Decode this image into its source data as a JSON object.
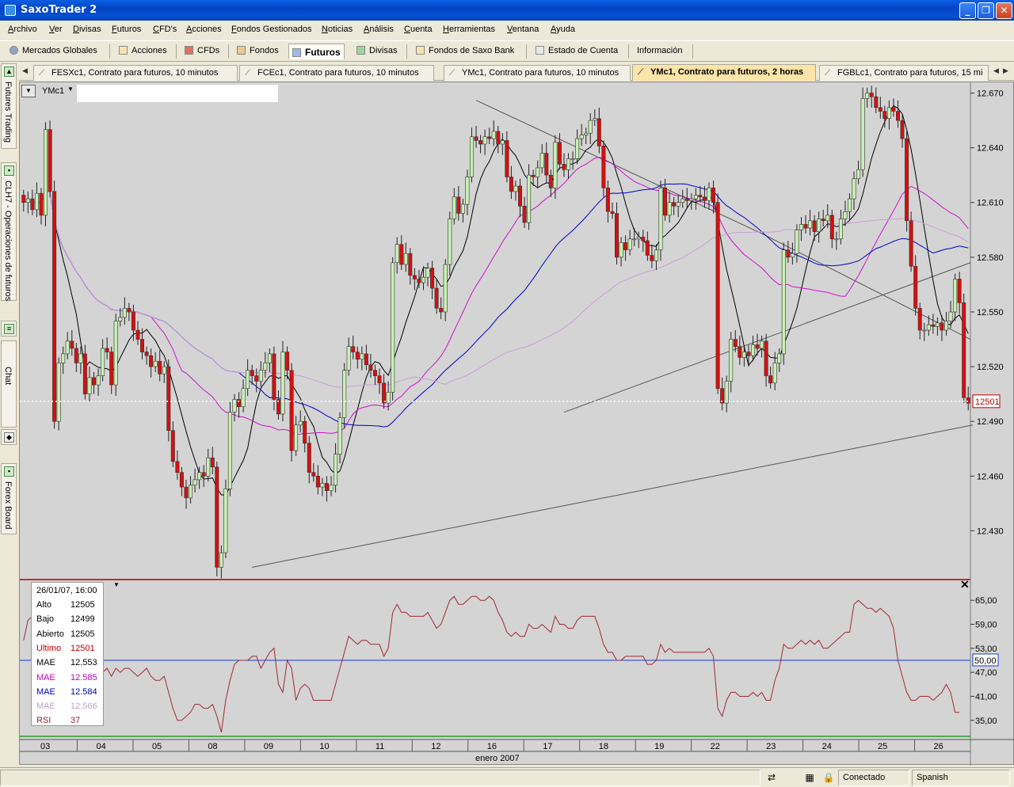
{
  "window": {
    "title": "SaxoTrader 2",
    "min": "_",
    "max": "❐",
    "close": "✕"
  },
  "menu": [
    "Archivo",
    "Ver",
    "Divisas",
    "Futuros",
    "CFD's",
    "Acciones",
    "Fondos Gestionados",
    "Noticias",
    "Análisis",
    "Cuenta",
    "Herramientas",
    "Ventana",
    "Ayuda"
  ],
  "toolbar": {
    "items": [
      "Mercados Globales",
      "Acciones",
      "CFDs",
      "Fondos",
      "Futuros",
      "Divisas",
      "Fondos de Saxo Bank",
      "Estado de Cuenta",
      "Información"
    ],
    "active": "Futuros"
  },
  "tabs": [
    "FESXc1, Contrato para futuros, 10 minutos",
    "FCEc1, Contrato para futuros, 10 minutos",
    "YMc1, Contrato para futuros, 10 minutos",
    "YMc1, Contrato para futuros, 2 horas",
    "FGBLc1, Contrato para futuros, 15 mi"
  ],
  "dock": [
    "Futures Trading",
    "CLH7 - Operaciones de futuros",
    "Chat",
    "Forex Board"
  ],
  "chart": {
    "symbol": "YMc1",
    "last_badge": "12501"
  },
  "chart_data": {
    "type": "candlestick",
    "symbol": "YMc1",
    "interval": "2 horas",
    "yticks": [
      12670,
      12640,
      12610,
      12580,
      12550,
      12520,
      12490,
      12460,
      12430
    ],
    "ytick_labels": [
      "12.670",
      "12.640",
      "12.610",
      "12.580",
      "12.550",
      "12.520",
      "12.490",
      "12.460",
      "12.430"
    ],
    "ylim": [
      12405,
      12675
    ],
    "last_price": 12501,
    "last_price_label": "12501",
    "x_day_labels": [
      "03",
      "04",
      "05",
      "08",
      "09",
      "10",
      "11",
      "12",
      "16",
      "17",
      "18",
      "19",
      "22",
      "23",
      "24",
      "25",
      "26"
    ],
    "x_month_label": "enero 2007",
    "close_series": [
      12610,
      12612,
      12606,
      12615,
      12603,
      12650,
      12616,
      12490,
      12522,
      12527,
      12534,
      12530,
      12522,
      12527,
      12505,
      12514,
      12510,
      12515,
      12530,
      12528,
      12510,
      12545,
      12547,
      12552,
      12550,
      12540,
      12535,
      12528,
      12526,
      12520,
      12523,
      12516,
      12520,
      12485,
      12468,
      12462,
      12454,
      12448,
      12455,
      12458,
      12462,
      12460,
      12470,
      12465,
      12410,
      12418,
      12453,
      12495,
      12502,
      12498,
      12508,
      12518,
      12515,
      12512,
      12518,
      12522,
      12527,
      12502,
      12494,
      12528,
      12518,
      12474,
      12488,
      12490,
      12478,
      12462,
      12460,
      12454,
      12456,
      12452,
      12455,
      12472,
      12492,
      12518,
      12531,
      12528,
      12524,
      12527,
      12521,
      12518,
      12515,
      12511,
      12500,
      12506,
      12577,
      12587,
      12576,
      12582,
      12570,
      12568,
      12566,
      12569,
      12574,
      12563,
      12552,
      12550,
      12576,
      12601,
      12613,
      12604,
      12609,
      12624,
      12646,
      12644,
      12642,
      12646,
      12645,
      12649,
      12642,
      12644,
      12624,
      12616,
      12619,
      12608,
      12599,
      12625,
      12624,
      12629,
      12637,
      12625,
      12618,
      12643,
      12631,
      12628,
      12634,
      12634,
      12645,
      12647,
      12648,
      12655,
      12656,
      12641,
      12618,
      12605,
      12604,
      12580,
      12588,
      12584,
      12590,
      12590,
      12591,
      12589,
      12581,
      12578,
      12584,
      12618,
      12603,
      12610,
      12608,
      12610,
      12612,
      12611,
      12612,
      12614,
      12613,
      12611,
      12618,
      12610,
      12508,
      12500,
      12512,
      12535,
      12531,
      12525,
      12528,
      12526,
      12532,
      12530,
      12534,
      12515,
      12511,
      12522,
      12527,
      12584,
      12580,
      12582,
      12595,
      12598,
      12596,
      12600,
      12594,
      12601,
      12600,
      12603,
      12590,
      12590,
      12601,
      12605,
      12612,
      12623,
      12628,
      12667,
      12670,
      12668,
      12662,
      12660,
      12656,
      12662,
      12660,
      12655,
      12645,
      12600,
      12575,
      12552,
      12540,
      12540,
      12543,
      12542,
      12544,
      12540,
      12545,
      12550,
      12568,
      12555,
      12503,
      12500
    ],
    "overlays": [
      {
        "name": "MAE",
        "value": 12553,
        "color": "#000000"
      },
      {
        "name": "MAE",
        "value": 12585,
        "color": "#d010d0"
      },
      {
        "name": "MAE",
        "value": 12584,
        "color": "#0000c8"
      },
      {
        "name": "MAE",
        "value": 12566,
        "color": "#c8a0d8"
      }
    ],
    "rsi": {
      "value": 37,
      "level": "50,00",
      "yticks": [
        "65,00",
        "59,00",
        "53,00",
        "47,00",
        "41,00",
        "35,00"
      ],
      "values": [
        55,
        60,
        61,
        62,
        53,
        57,
        60,
        47,
        46,
        48,
        47,
        47,
        45,
        42,
        42,
        41,
        43,
        43,
        47,
        48,
        46,
        48,
        47,
        48,
        48,
        47,
        46,
        47,
        48,
        46,
        45,
        45,
        46,
        42,
        38,
        35,
        35,
        36,
        37,
        39,
        39,
        38,
        38,
        39,
        36,
        32,
        40,
        45,
        49,
        50,
        50,
        50,
        51,
        51,
        48,
        50,
        52,
        53,
        44,
        42,
        50,
        48,
        40,
        43,
        44,
        43,
        40,
        40,
        40,
        40,
        40,
        44,
        48,
        52,
        56,
        55,
        54,
        55,
        55,
        54,
        54,
        54,
        51,
        53,
        62,
        64,
        62,
        62,
        61,
        61,
        61,
        61,
        62,
        60,
        58,
        59,
        62,
        65,
        66,
        64,
        64,
        65,
        66,
        66,
        65,
        65,
        66,
        65,
        62,
        60,
        57,
        56,
        57,
        56,
        56,
        59,
        58,
        58,
        59,
        58,
        57,
        61,
        59,
        59,
        58,
        58,
        60,
        61,
        61,
        61,
        61,
        58,
        54,
        52,
        52,
        50,
        50,
        51,
        51,
        51,
        51,
        51,
        49,
        49,
        50,
        54,
        52,
        53,
        52,
        52,
        52,
        52,
        52,
        52,
        52,
        52,
        53,
        51,
        38,
        36,
        40,
        42,
        42,
        41,
        41,
        41,
        42,
        41,
        42,
        40,
        40,
        45,
        48,
        54,
        53,
        53,
        54,
        55,
        54,
        55,
        54,
        55,
        53,
        53,
        54,
        55,
        56,
        57,
        57,
        64,
        65,
        64,
        63,
        63,
        62,
        63,
        62,
        61,
        58,
        50,
        46,
        42,
        40,
        40,
        41,
        41,
        41,
        40,
        41,
        42,
        44,
        42,
        37,
        37
      ]
    }
  },
  "infobox": {
    "header": "26/01/07, 16:00",
    "rows": [
      {
        "label": "Alto",
        "value": "12505",
        "color": "#000000"
      },
      {
        "label": "Bajo",
        "value": "12499",
        "color": "#000000"
      },
      {
        "label": "Abierto",
        "value": "12505",
        "color": "#000000"
      },
      {
        "label": "Ultimo",
        "value": "12501",
        "color": "#c00000"
      },
      {
        "label": "MAE",
        "value": "12.553",
        "color": "#000000"
      },
      {
        "label": "MAE",
        "value": "12.585",
        "color": "#c000c0"
      },
      {
        "label": "MAE",
        "value": "12.584",
        "color": "#0000c0"
      },
      {
        "label": "MAE",
        "value": "12.566",
        "color": "#c0a0c8"
      },
      {
        "label": "RSI",
        "value": "37",
        "color": "#a02030"
      }
    ]
  },
  "status": {
    "connection": "Conectado",
    "language": "Spanish"
  }
}
